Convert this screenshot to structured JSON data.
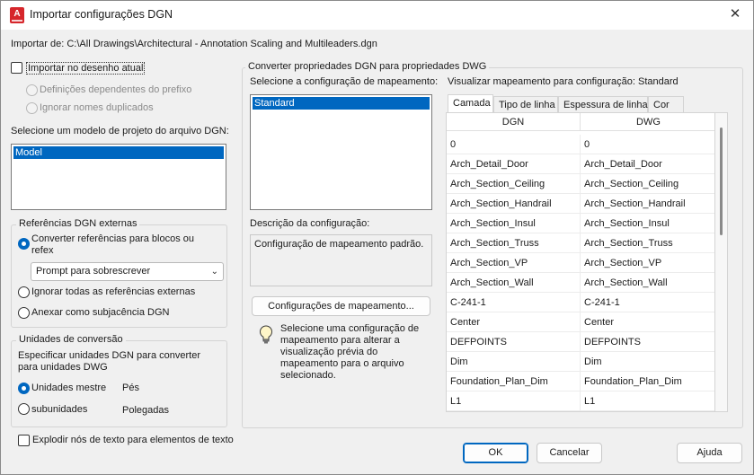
{
  "window": {
    "title": "Importar configurações DGN",
    "close_glyph": "✕",
    "app_icon_letter": "A"
  },
  "import_from": "Importar de: C:\\All Drawings\\Architectural - Annotation Scaling and Multileaders.dgn",
  "left": {
    "import_current_label": "Importar no desenho atual",
    "prefix_option": "Definições dependentes do prefixo",
    "ignore_dup_option": "Ignorar nomes duplicados",
    "template_label": "Selecione um modelo de projeto do arquivo DGN:",
    "template_items": [
      "Model"
    ],
    "xref_group_title": "Referências DGN externas",
    "xref_convert_label": "Converter referências para blocos ou refex",
    "xref_combo_value": "Prompt para sobrescrever",
    "xref_ignore_label": "Ignorar todas as referências externas",
    "xref_attach_label": "Anexar como subjacência DGN",
    "units_group_title": "Unidades de conversão",
    "units_desc": "Especificar unidades DGN para converter para unidades DWG",
    "master_units_label": "Unidades mestre",
    "master_units_value": "Pés",
    "sub_units_label": "subunidades",
    "sub_units_value": "Polegadas",
    "explode_label": "Explodir nós de texto para elementos de texto"
  },
  "middle": {
    "group_title": "Converter propriedades DGN para propriedades DWG",
    "select_config_label": "Selecione a configuração de  mapeamento:",
    "config_items": [
      "Standard"
    ],
    "desc_label": "Descrição da configuração:",
    "desc_text": "Configuração de mapeamento padrão.",
    "mapping_button": "Configurações de mapeamento...",
    "hint_text": "Selecione uma configuração de mapeamento para alterar a visualização prévia do mapeamento para o arquivo selecionado."
  },
  "preview": {
    "label": "Visualizar mapeamento para configuração: Standard",
    "tabs": [
      "Camada",
      "Tipo de linha",
      "Espessura de linha",
      "Cor"
    ],
    "active_tab": "Camada",
    "columns": [
      "DGN",
      "DWG"
    ],
    "rows": [
      [
        "0",
        "0"
      ],
      [
        "Arch_Detail_Door",
        "Arch_Detail_Door"
      ],
      [
        "Arch_Section_Ceiling",
        "Arch_Section_Ceiling"
      ],
      [
        "Arch_Section_Handrail",
        "Arch_Section_Handrail"
      ],
      [
        "Arch_Section_Insul",
        "Arch_Section_Insul"
      ],
      [
        "Arch_Section_Truss",
        "Arch_Section_Truss"
      ],
      [
        "Arch_Section_VP",
        "Arch_Section_VP"
      ],
      [
        "Arch_Section_Wall",
        "Arch_Section_Wall"
      ],
      [
        "C-241-1",
        "C-241-1"
      ],
      [
        "Center",
        "Center"
      ],
      [
        "DEFPOINTS",
        "DEFPOINTS"
      ],
      [
        "Dim",
        "Dim"
      ],
      [
        "Foundation_Plan_Dim",
        "Foundation_Plan_Dim"
      ],
      [
        "L1",
        "L1"
      ]
    ]
  },
  "buttons": {
    "ok": "OK",
    "cancel": "Cancelar",
    "help": "Ajuda"
  }
}
